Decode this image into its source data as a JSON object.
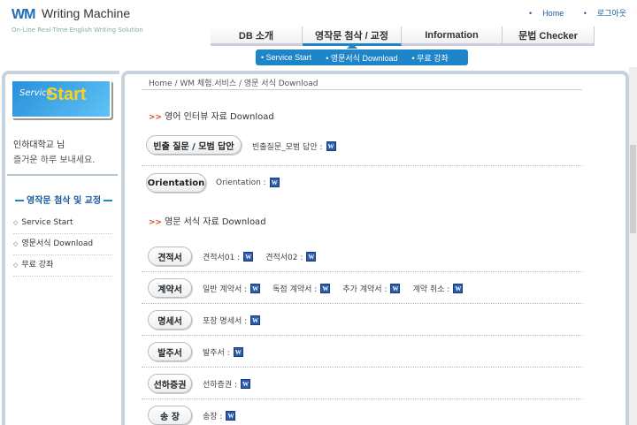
{
  "header": {
    "logo_mark": "WM",
    "logo_text": "Writing Machine",
    "tagline": "On-Line Real-Time English Writing Solution",
    "links": [
      "Home",
      "로그아웃"
    ]
  },
  "nav": {
    "tabs": [
      "DB 소개",
      "영작문 첨삭 / 교정",
      "Information",
      "문법 Checker"
    ],
    "subnav": [
      "Service Start",
      "영문서식 Download",
      "무료 강좌"
    ]
  },
  "sidebar": {
    "start_small": "Service",
    "start_big": "Start",
    "user": "인하대학교 님",
    "welcome": "즐거운 하루 보내세요.",
    "section_title": "영작문 첨삭 및 교정",
    "items": [
      "Service Start",
      "영문서식 Download",
      "무료 강좌"
    ]
  },
  "main": {
    "breadcrumb": "Home / WM 체험.서비스 / 영문 서식 Download",
    "section1_title": "영어 인터뷰 자료 Download",
    "section2_title": "영문 서식 자료 Download",
    "rows": [
      {
        "label": "빈출 질문 / 모범 답안",
        "files": [
          "빈출질문_모범 답안 :"
        ]
      },
      {
        "label": "Orientation",
        "files": [
          "Orientation :"
        ]
      },
      {
        "label": "견적서",
        "files": [
          "견적서01 :",
          "견적서02 :"
        ]
      },
      {
        "label": "계약서",
        "files": [
          "일반 계약서 :",
          "독점 계약서 :",
          "추가 계약서 :",
          "계약 취소 :"
        ]
      },
      {
        "label": "명세서",
        "files": [
          "포장 명세서 :"
        ]
      },
      {
        "label": "발주서",
        "files": [
          "발주서 :"
        ]
      },
      {
        "label": "선하증권",
        "files": [
          "선하증권 :"
        ]
      },
      {
        "label": "송 장",
        "files": [
          "송장 :"
        ]
      }
    ],
    "file_icon": "W",
    "icon_names": {
      "file": "word-doc-icon",
      "arrow": "double-arrow-icon"
    }
  },
  "colors": {
    "accent": "#1f85c9",
    "logo_orange": "#e07a10",
    "logo_blue": "#1d6fb8"
  }
}
